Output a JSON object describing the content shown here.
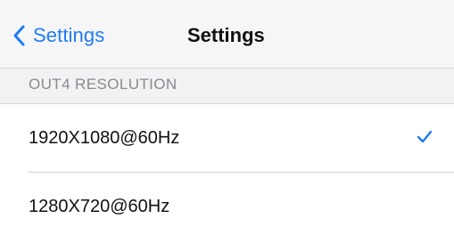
{
  "navbar": {
    "back_label": "Settings",
    "title": "Settings"
  },
  "section": {
    "header": "OUT4 RESOLUTION"
  },
  "options": [
    {
      "label": "1920X1080@60Hz",
      "selected": true
    },
    {
      "label": "1280X720@60Hz",
      "selected": false
    }
  ],
  "icons": {
    "back": "chevron-left-icon",
    "selected": "checkmark-icon"
  },
  "colors": {
    "accent": "#1f7cf5",
    "navbar_bg": "#f6f6f7",
    "section_bg": "#f2f2f5"
  }
}
